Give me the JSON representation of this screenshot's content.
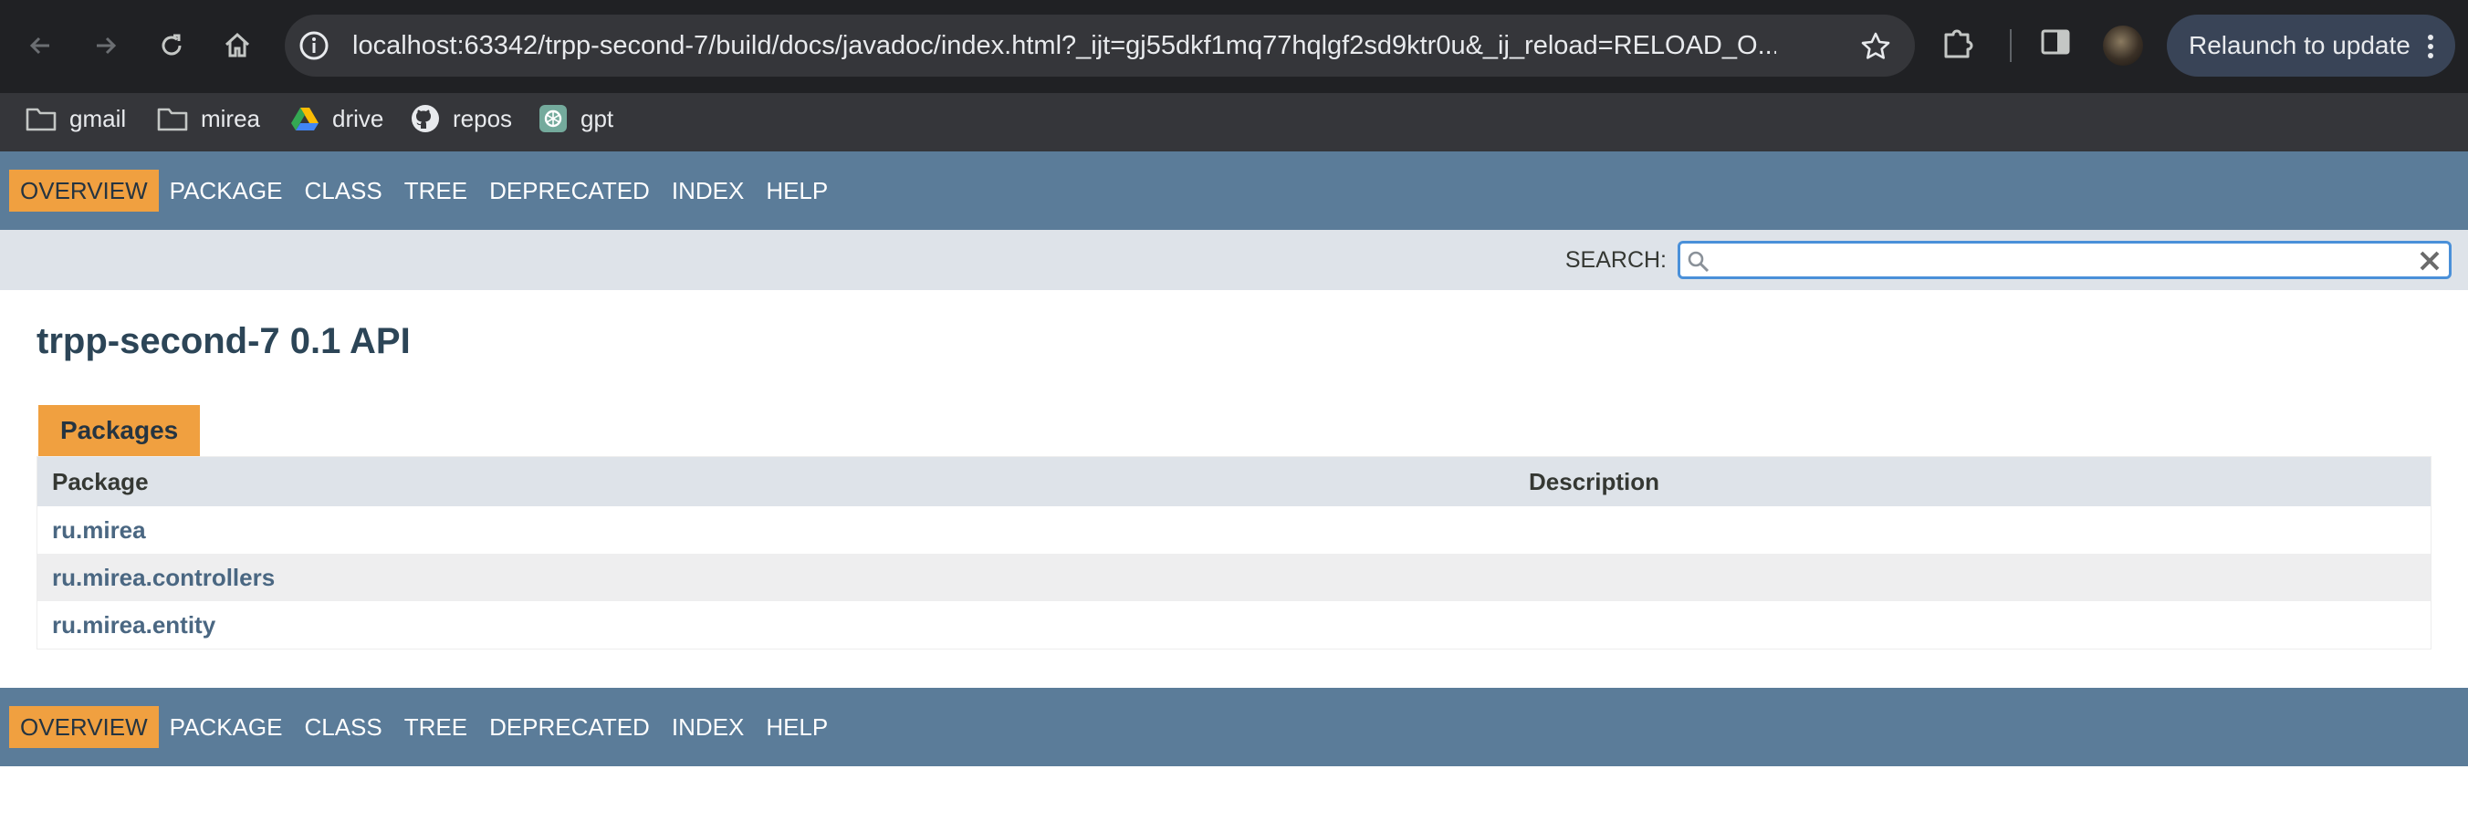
{
  "browser": {
    "url": "localhost:63342/trpp-second-7/build/docs/javadoc/index.html?_ijt=gj55dkf1mq77hqlgf2sd9ktr0u&_ij_reload=RELOAD_O...",
    "relaunch_label": "Relaunch to update",
    "bookmarks": [
      {
        "label": "gmail",
        "icon": "folder-icon"
      },
      {
        "label": "mirea",
        "icon": "folder-icon"
      },
      {
        "label": "drive",
        "icon": "google-drive-icon"
      },
      {
        "label": "repos",
        "icon": "github-icon"
      },
      {
        "label": "gpt",
        "icon": "chatgpt-icon"
      }
    ]
  },
  "nav": {
    "items": [
      "Overview",
      "Package",
      "Class",
      "Tree",
      "Deprecated",
      "Index",
      "Help"
    ],
    "active": "Overview"
  },
  "search": {
    "label": "SEARCH:",
    "value": ""
  },
  "page": {
    "title": "trpp-second-7 0.1 API"
  },
  "packages": {
    "caption": "Packages",
    "headers": [
      "Package",
      "Description"
    ],
    "rows": [
      {
        "name": "ru.mirea",
        "description": ""
      },
      {
        "name": "ru.mirea.controllers",
        "description": ""
      },
      {
        "name": "ru.mirea.entity",
        "description": ""
      }
    ]
  },
  "colors": {
    "nav_bg": "#5b7c99",
    "active_tab": "#f0a040",
    "link": "#4a6782"
  }
}
